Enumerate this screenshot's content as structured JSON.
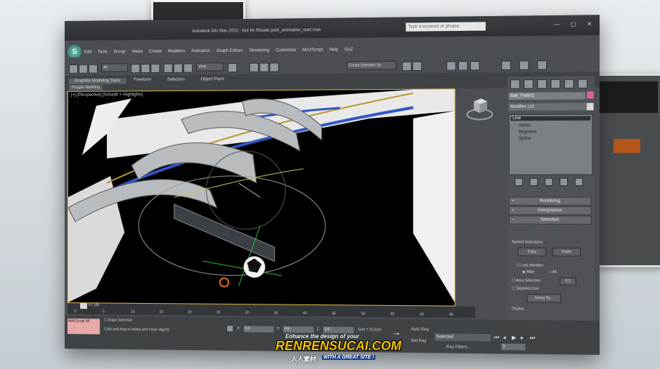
{
  "window": {
    "title": "Autodesk 3ds Max 2013 - Not for Resale   path_animation_start.max",
    "search_placeholder": "Type a keyword or phrase",
    "app_icon_glyph": "S"
  },
  "menu": [
    "Edit",
    "Tools",
    "Group",
    "Views",
    "Create",
    "Modifiers",
    "Animation",
    "Graph Editors",
    "Rendering",
    "Customize",
    "MAXScript",
    "Help",
    "GoZ"
  ],
  "toolbar": {
    "selection_filter": "All",
    "reference_coord": "View",
    "named_selection": "Create Selection Se"
  },
  "ribbon": {
    "tabs": [
      "Graphite Modeling Tools",
      "Freeform",
      "Selection",
      "Object Paint"
    ],
    "subtab": "Polygon Modeling"
  },
  "viewport": {
    "label": "[+] [Perspective] [Smooth + Highlights]"
  },
  "command_panel": {
    "object_name": "Ball_Path01",
    "modifier_list": "Modifier List",
    "stack": [
      "Line",
      "Vertex",
      "Segment",
      "Spline"
    ],
    "rollouts": {
      "rendering": "Rendering",
      "interpolation": "Interpolation",
      "selection": "Selection"
    },
    "named_selections": "Named Selections:",
    "copy_btn": "Copy",
    "paste_btn": "Paste",
    "lock_handles": "Lock Handles",
    "alike": "Alike",
    "all": "All",
    "area_selection": "Area Selection:",
    "area_value": "0.1",
    "segment_end": "Segment End",
    "select_by": "Select By...",
    "display": "Display"
  },
  "timeline": {
    "frame_label": "0 / 100",
    "ticks": [
      "0",
      "5",
      "10",
      "15",
      "20",
      "25",
      "30",
      "35",
      "40",
      "45",
      "50",
      "55",
      "60",
      "65"
    ]
  },
  "status": {
    "maxscript": "MAXScript Mi",
    "shapes_selected": "1 Shape Selected",
    "hint": "Click and drag to select and move objects",
    "x": "0.0",
    "y": "0.0",
    "z": "0.0",
    "grid": "Grid = 10.0cm",
    "auto_key": "Auto Key",
    "set_key": "Set Key",
    "key_filters": "Key Filters...",
    "selected_dropdown": "Selected",
    "frame": "0"
  },
  "watermark": {
    "tagline": "Enhance the design of your",
    "brand": "RENRENSUCAI.COM",
    "chinese": "人人素材",
    "slogan": "WITH A GREAT SITE !"
  },
  "colors": {
    "viewport_bg": "#000000",
    "rail_gray": "#b9bcbe",
    "blue_rail": "#2f56c8",
    "highlight_yellow": "#e0b84a",
    "object_color": "#e05fa0"
  }
}
